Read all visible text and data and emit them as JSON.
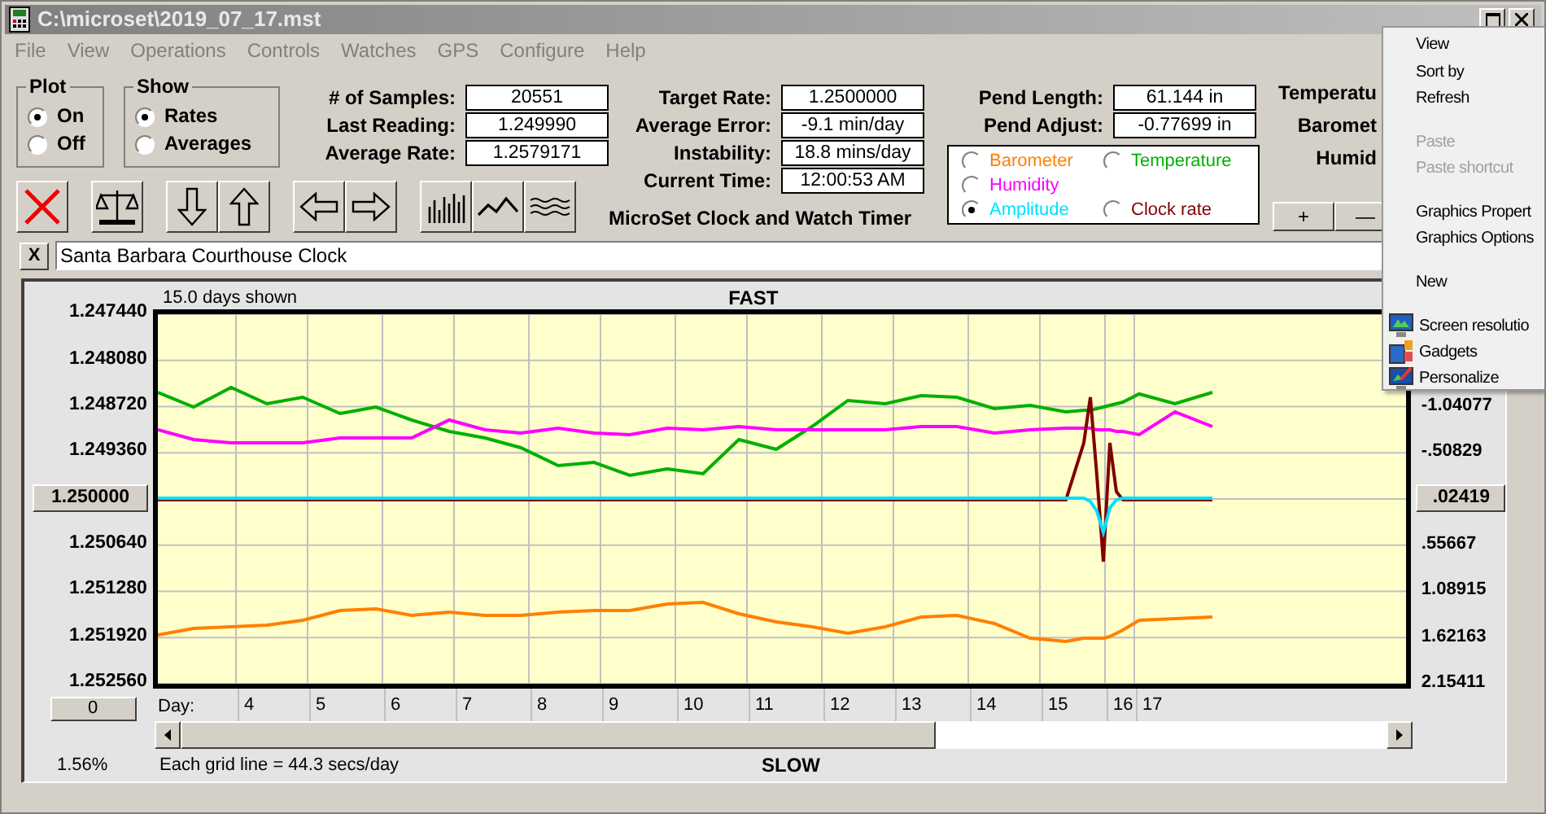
{
  "window": {
    "title": "C:\\microset\\2019_07_17.mst"
  },
  "menu": [
    "File",
    "View",
    "Operations",
    "Controls",
    "Watches",
    "GPS",
    "Configure",
    "Help"
  ],
  "plot_group": {
    "title": "Plot",
    "options": [
      {
        "label": "On",
        "selected": true
      },
      {
        "label": "Off",
        "selected": false
      }
    ]
  },
  "show_group": {
    "title": "Show",
    "options": [
      {
        "label": "Rates",
        "selected": true
      },
      {
        "label": "Averages",
        "selected": false
      }
    ]
  },
  "stats_columns": [
    [
      {
        "label": "# of Samples:",
        "value": "20551"
      },
      {
        "label": "Last Reading:",
        "value": "1.249990"
      },
      {
        "label": "Average Rate:",
        "value": "1.2579171"
      }
    ],
    [
      {
        "label": "Target Rate:",
        "value": "1.2500000"
      },
      {
        "label": "Average Error:",
        "value": "-9.1 min/day"
      },
      {
        "label": "Instability:",
        "value": "18.8 mins/day"
      },
      {
        "label": "Current Time:",
        "value": "12:00:53 AM"
      }
    ],
    [
      {
        "label": "Pend Length:",
        "value": "61.144 in"
      },
      {
        "label": "Pend Adjust:",
        "value": "-0.77699 in"
      }
    ]
  ],
  "app_title": "MicroSet Clock and Watch Timer",
  "sensor_options": [
    {
      "label": "Barometer",
      "color": "#ff8000",
      "selected": false
    },
    {
      "label": "Temperature",
      "color": "#00b000",
      "selected": false
    },
    {
      "label": "Humidity",
      "color": "#ff00ff",
      "selected": false
    },
    {
      "label": "Amplitude",
      "color": "#00e0ff",
      "selected": true
    },
    {
      "label": "Clock rate",
      "color": "#800000",
      "selected": false
    }
  ],
  "side_labels": [
    "Temperatu",
    "Baromet",
    "Humid"
  ],
  "zoom_buttons": [
    "+",
    "—"
  ],
  "clear_button": "X",
  "clock_name": {
    "value": "Santa Barbara Courthouse Clock"
  },
  "chart": {
    "days_shown": "15.0 days shown",
    "top_label": "FAST",
    "bottom_label": "SLOW",
    "grid_note": "Each grid line = 44.3 secs/day",
    "percent": "1.56%",
    "offset_button": "0",
    "day_label": "Day:",
    "left_axis": [
      {
        "label": "1.247440",
        "kind": "text"
      },
      {
        "label": "1.248080",
        "kind": "text"
      },
      {
        "label": "1.248720",
        "kind": "text"
      },
      {
        "label": "1.249360",
        "kind": "text"
      },
      {
        "label": "1.250000",
        "kind": "button"
      },
      {
        "label": "1.250640",
        "kind": "text"
      },
      {
        "label": "1.251280",
        "kind": "text"
      },
      {
        "label": "1.251920",
        "kind": "text"
      },
      {
        "label": "1.252560",
        "kind": "text"
      }
    ],
    "right_axis": [
      {
        "label": "-1.04077",
        "kind": "text"
      },
      {
        "label": "-.50829",
        "kind": "text"
      },
      {
        "label": ".02419",
        "kind": "button"
      },
      {
        "label": ".55667",
        "kind": "text"
      },
      {
        "label": "1.08915",
        "kind": "text"
      },
      {
        "label": "1.62163",
        "kind": "text"
      },
      {
        "label": "2.15411",
        "kind": "text"
      }
    ],
    "day_ticks": [
      "4",
      "5",
      "6",
      "7",
      "8",
      "9",
      "10",
      "11",
      "12",
      "13",
      "14",
      "15",
      "16",
      "17"
    ]
  },
  "context_menu": [
    {
      "kind": "item",
      "label": "View",
      "disabled": false
    },
    {
      "kind": "item",
      "label": "Sort by",
      "disabled": false
    },
    {
      "kind": "item",
      "label": "Refresh",
      "disabled": false
    },
    {
      "kind": "separator"
    },
    {
      "kind": "item",
      "label": "Paste",
      "disabled": true
    },
    {
      "kind": "item",
      "label": "Paste shortcut",
      "disabled": true
    },
    {
      "kind": "separator"
    },
    {
      "kind": "item",
      "label": "Graphics Propert",
      "disabled": false
    },
    {
      "kind": "item",
      "label": "Graphics Options",
      "disabled": false
    },
    {
      "kind": "separator"
    },
    {
      "kind": "item",
      "label": "New",
      "disabled": false
    },
    {
      "kind": "separator"
    },
    {
      "kind": "icon_item",
      "label": "Screen resolutio",
      "disabled": false
    },
    {
      "kind": "icon_item",
      "label": "Gadgets",
      "disabled": false
    },
    {
      "kind": "icon_item",
      "label": "Personalize",
      "disabled": false
    }
  ]
}
